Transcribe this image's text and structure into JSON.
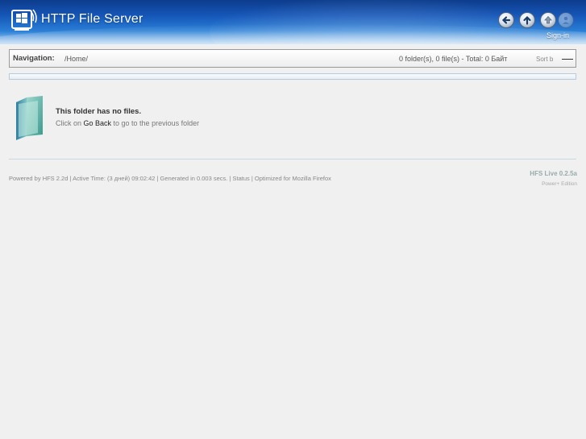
{
  "header": {
    "app_title": "HTTP File Server",
    "logo_icon": "windows-server-logo",
    "buttons": [
      {
        "name": "back",
        "icon": "arrow-left-icon"
      },
      {
        "name": "up",
        "icon": "arrow-up-icon"
      },
      {
        "name": "upload",
        "icon": "upload-icon"
      },
      {
        "name": "account",
        "icon": "user-icon"
      }
    ],
    "signin_label": "Sign-in"
  },
  "navigation": {
    "label": "Navigation:",
    "path": "/Home/",
    "summary": "0 folder(s), 0 file(s) - Total: 0 Байт",
    "sort_label": "Sort b"
  },
  "empty_state": {
    "title": "This folder has no files.",
    "hint_prefix": "Click on ",
    "hint_link": "Go Back",
    "hint_suffix": " to go to the previous folder"
  },
  "footer": {
    "powered_by": "Powered by HFS 2.2d",
    "active_time": "Active Time: (3 дней) 09:02:42",
    "generated": "Generated in 0.003 secs.",
    "status_link": "Status",
    "optimized": "Optimized for Mozilla Firefox",
    "separator": " | ",
    "brand": "HFS Live 0.2.5a",
    "edition": "Power+ Edition"
  },
  "colors": {
    "header_top": "#0d3c8c",
    "header_bottom": "#b9d8f3",
    "page_background": "#f0f0f0"
  }
}
